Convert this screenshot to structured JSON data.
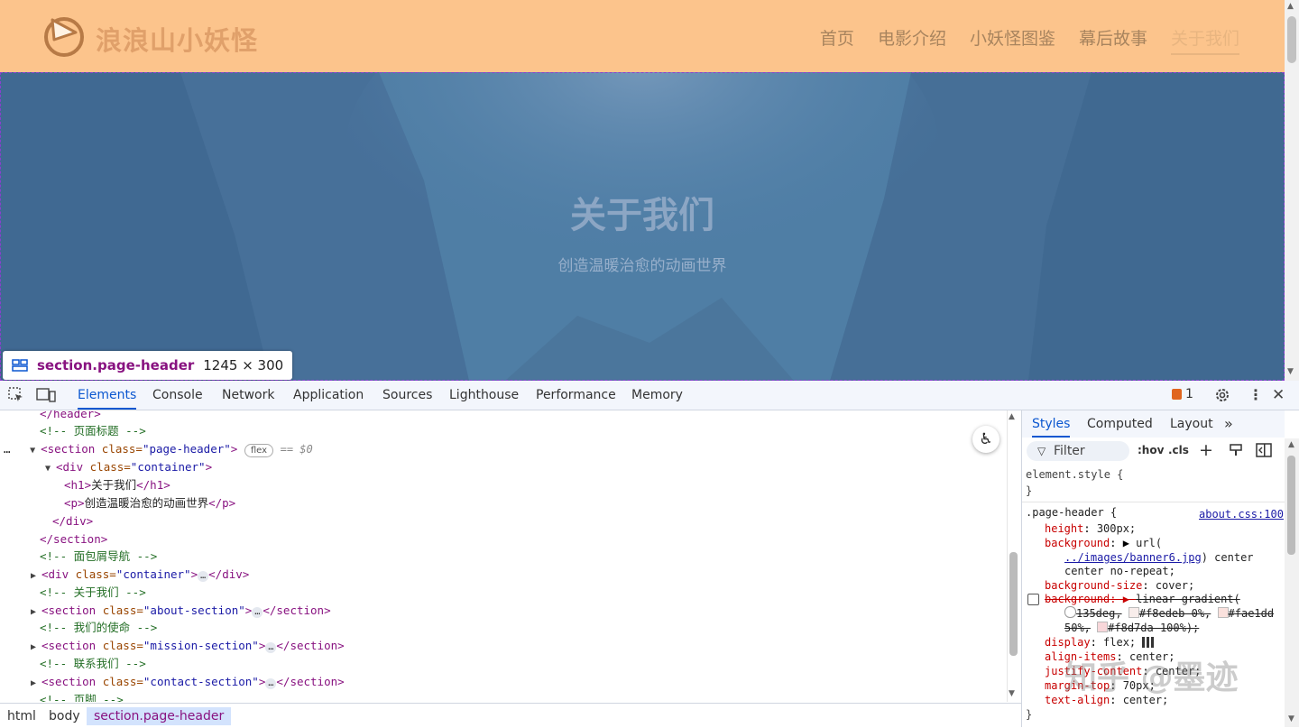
{
  "site": {
    "logo_text": "浪浪山小妖怪",
    "nav": [
      "首页",
      "电影介绍",
      "小妖怪图鉴",
      "幕后故事",
      "关于我们"
    ],
    "active_nav": "关于我们",
    "hero_title": "关于我们",
    "hero_subtitle": "创造温暖治愈的动画世界"
  },
  "tooltip": {
    "selector": "section.page-header",
    "size": "1245 × 300"
  },
  "devtools": {
    "tabs": [
      "Elements",
      "Console",
      "Network",
      "Application",
      "Sources",
      "Lighthouse",
      "Performance",
      "Memory"
    ],
    "active_tab": "Elements",
    "issues_count": "1",
    "dom": {
      "l0": "</header>",
      "l1": "<!-- 页面标题 -->",
      "l2_tag": "<section ",
      "l2_attr": "class=",
      "l2_val": "\"page-header\"",
      "l2_close": ">",
      "l2_badge": "flex",
      "l2_ref": "== $0",
      "l3_tag": "<div ",
      "l3_attr": "class=",
      "l3_val": "\"container\"",
      "l3_close": ">",
      "l4_open": "<h1>",
      "l4_text": "关于我们",
      "l4_close": "</h1>",
      "l5_open": "<p>",
      "l5_text": "创造温暖治愈的动画世界",
      "l5_close": "</p>",
      "l6": "</div>",
      "l7": "</section>",
      "l8": "<!-- 面包屑导航 -->",
      "l9_tag": "<div ",
      "l9_attr": "class=",
      "l9_val": "\"container\"",
      "l9_close": ">",
      "l9_end": "</div>",
      "l10": "<!-- 关于我们 -->",
      "l11_tag": "<section ",
      "l11_attr": "class=",
      "l11_val": "\"about-section\"",
      "l11_close": ">",
      "l11_end": "</section>",
      "l12": "<!-- 我们的使命 -->",
      "l13_tag": "<section ",
      "l13_attr": "class=",
      "l13_val": "\"mission-section\"",
      "l13_close": ">",
      "l13_end": "</section>",
      "l14": "<!-- 联系我们 -->",
      "l15_tag": "<section ",
      "l15_attr": "class=",
      "l15_val": "\"contact-section\"",
      "l15_close": ">",
      "l15_end": "</section>",
      "l16": "<!-- 页脚 -->",
      "collapsed": "…",
      "row_menu": "…"
    },
    "breadcrumbs": [
      "html",
      "body",
      "section.page-header"
    ],
    "styles": {
      "tabs": [
        "Styles",
        "Computed",
        "Layout"
      ],
      "more": "»",
      "filter_placeholder": "Filter",
      "hov": ":hov",
      "cls": ".cls",
      "element_style": "element.style {",
      "close_brace": "}",
      "rule_selector": ".page-header {",
      "rule_source": "about.css:100",
      "height_prop": "height",
      "height_val": "300px;",
      "bg_prop": "background",
      "bg_val_1": "url(",
      "bg_url": "../images/banner6.jpg",
      "bg_val_2": ") center",
      "bg_val_3": "center no-repeat;",
      "bgsize_prop": "background-size",
      "bgsize_val": "cover;",
      "bg2_prop": "background",
      "bg2_val_1": "linear-gradient(",
      "bg2_val_2": "135deg,",
      "bg2_c1": "#f8edeb 0%,",
      "bg2_c2": "#fae1dd",
      "bg2_val_3": "50%,",
      "bg2_c3": "#f8d7da 100%);",
      "display_prop": "display",
      "display_val": "flex;",
      "align_prop": "align-items",
      "align_val": "center;",
      "justify_prop": "justify-content",
      "justify_val": "center;",
      "margin_prop": "margin-top",
      "margin_val": "70px;",
      "textalign_prop": "text-align",
      "textalign_val": "center;"
    },
    "watermark": "知乎 @墨迹"
  },
  "colors": {
    "header_bg": "#fcc48c",
    "banner_bg": "#4f7da8",
    "selection_tag": "#881280",
    "devtools_accent": "#0b57d0"
  }
}
